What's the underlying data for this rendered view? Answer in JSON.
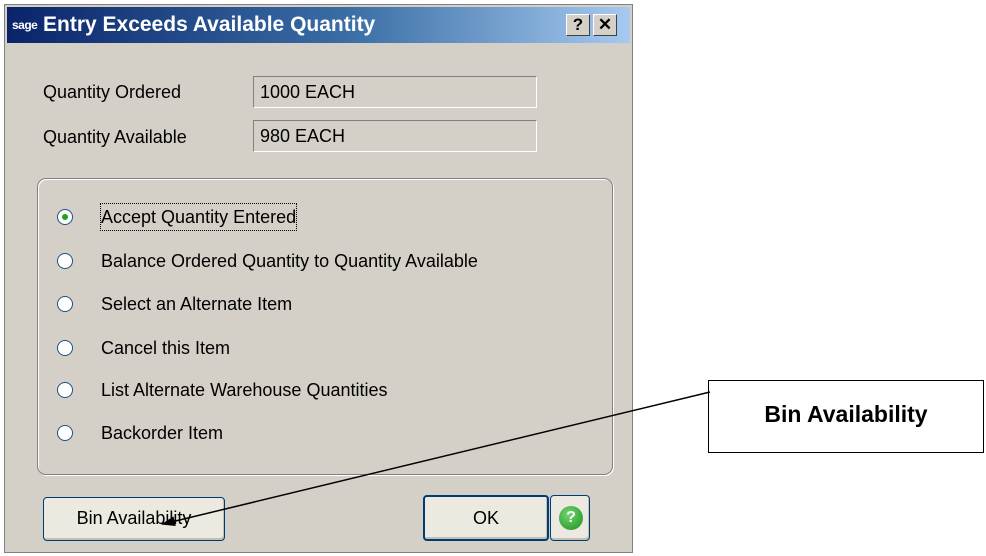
{
  "dialog": {
    "logo_text": "sage",
    "title": "Entry Exceeds Available Quantity",
    "help_button": "?",
    "close_button": "✕"
  },
  "fields": {
    "quantity_ordered_label": "Quantity Ordered",
    "quantity_ordered_value": "1000 EACH",
    "quantity_available_label": "Quantity Available",
    "quantity_available_value": "980 EACH"
  },
  "options": [
    {
      "label": "Accept Quantity Entered",
      "selected": true
    },
    {
      "label": "Balance Ordered Quantity to Quantity Available",
      "selected": false
    },
    {
      "label": "Select an Alternate Item",
      "selected": false
    },
    {
      "label": "Cancel this Item",
      "selected": false
    },
    {
      "label": "List Alternate Warehouse Quantities",
      "selected": false
    },
    {
      "label": "Backorder Item",
      "selected": false
    }
  ],
  "buttons": {
    "bin_availability_label": "Bin Availability",
    "ok_label": "OK",
    "help_icon": "?"
  },
  "annotation": {
    "callout_text": "Bin Availability"
  }
}
